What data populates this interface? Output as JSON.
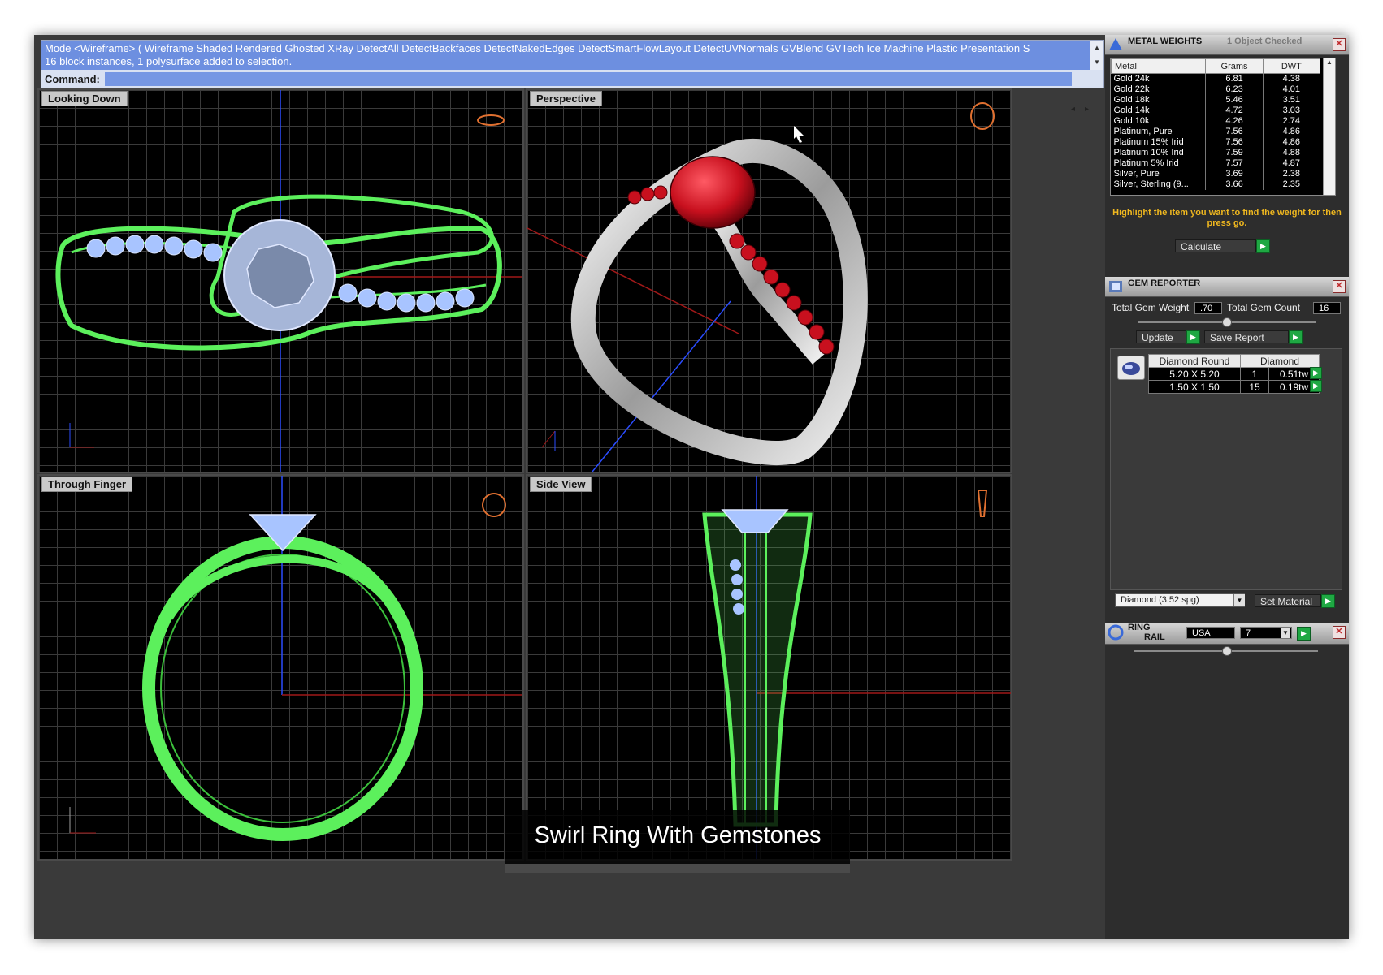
{
  "command_area": {
    "history_line1": "Mode <Wireframe> ( Wireframe  Shaded  Rendered  Ghosted  XRay  DetectAll  DetectBackfaces  DetectNakedEdges  DetectSmartFlowLayout  DetectUVNormals  GVBlend  GVTech  Ice  Machine  Plastic  Presentation  S",
    "history_line2": "16 block instances, 1 polysurface added to selection.",
    "prompt_label": "Command:"
  },
  "viewports": {
    "top_left": {
      "title": "Looking Down"
    },
    "top_right": {
      "title": "Perspective"
    },
    "bottom_left": {
      "title": "Through Finger"
    },
    "bottom_right": {
      "title": "Side View"
    }
  },
  "metal_weights": {
    "title": "METAL WEIGHTS",
    "status": "1 Object Checked",
    "columns": [
      "Metal",
      "Grams",
      "DWT"
    ],
    "rows": [
      [
        "Gold 24k",
        "6.81",
        "4.38"
      ],
      [
        "Gold 22k",
        "6.23",
        "4.01"
      ],
      [
        "Gold 18k",
        "5.46",
        "3.51"
      ],
      [
        "Gold 14k",
        "4.72",
        "3.03"
      ],
      [
        "Gold 10k",
        "4.26",
        "2.74"
      ],
      [
        "Platinum, Pure",
        "7.56",
        "4.86"
      ],
      [
        "Platinum 15% Irid",
        "7.56",
        "4.86"
      ],
      [
        "Platinum 10% Irid",
        "7.59",
        "4.88"
      ],
      [
        "Platinum 5% Irid",
        "7.57",
        "4.87"
      ],
      [
        "Silver, Pure",
        "3.69",
        "2.38"
      ],
      [
        "Silver, Sterling (9...",
        "3.66",
        "2.35"
      ]
    ],
    "hint": "Highlight the item you want to find the weight for then press go.",
    "calculate_label": "Calculate"
  },
  "gem_reporter": {
    "title": "GEM REPORTER",
    "total_weight_label": "Total Gem Weight",
    "total_weight_value": ".70",
    "total_count_label": "Total Gem Count",
    "total_count_value": "16",
    "update_label": "Update",
    "save_report_label": "Save Report",
    "table_headers": [
      "Diamond Round",
      "Diamond"
    ],
    "rows": [
      {
        "size": "5.20 X 5.20",
        "count": "1",
        "weight": "0.51tw"
      },
      {
        "size": "1.50 X 1.50",
        "count": "15",
        "weight": "0.19tw"
      }
    ],
    "material_select": "Diamond     (3.52 spg)",
    "set_material_label": "Set Material"
  },
  "ring_rail": {
    "title_line1": "RING",
    "title_line2": "RAIL",
    "country": "USA",
    "size": "7"
  },
  "caption": "Swirl Ring With Gemstones",
  "colors": {
    "wire_green": "#5cf05c",
    "wire_blue": "#a8c4ff",
    "ruby": "#c8101e",
    "silver": "#d8d8d8",
    "command_blue": "#6d8fe0",
    "hint_yellow": "#f0b81f",
    "go_green": "#1fa843"
  }
}
